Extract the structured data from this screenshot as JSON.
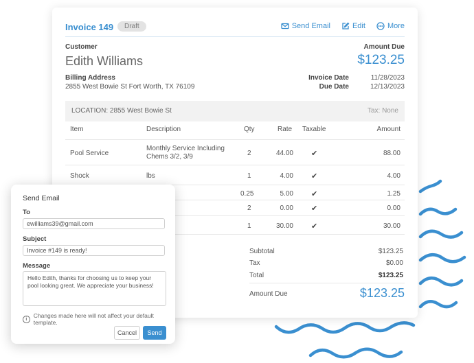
{
  "invoice": {
    "title": "Invoice 149",
    "status": "Draft",
    "actions": {
      "send_email": "Send Email",
      "edit": "Edit",
      "more": "More"
    },
    "customer_label": "Customer",
    "customer_name": "Edith Williams",
    "amount_due_label": "Amount Due",
    "amount_due": "$123.25",
    "billing_label": "Billing Address",
    "billing_address": "2855 West Bowie St Fort Worth, TX 76109",
    "invoice_date_label": "Invoice Date",
    "invoice_date": "11/28/2023",
    "due_date_label": "Due Date",
    "due_date": "12/13/2023",
    "location": "LOCATION: 2855 West Bowie St",
    "tax_label": "Tax: None",
    "columns": [
      "Item",
      "Description",
      "Qty",
      "Rate",
      "Taxable",
      "Amount"
    ],
    "rows": [
      {
        "item": "Pool Service",
        "desc": "Monthly Service Including Chems 3/2, 3/9",
        "qty": "2",
        "rate": "44.00",
        "taxable": "✔",
        "amount": "88.00"
      },
      {
        "item": "Shock",
        "desc": "lbs",
        "qty": "1",
        "rate": "4.00",
        "taxable": "✔",
        "amount": "4.00"
      },
      {
        "item": "",
        "desc": "",
        "qty": "0.25",
        "rate": "5.00",
        "taxable": "✔",
        "amount": "1.25"
      },
      {
        "item": "",
        "desc": "",
        "qty": "2",
        "rate": "0.00",
        "taxable": "✔",
        "amount": "0.00"
      },
      {
        "item": "",
        "desc": "",
        "qty": "1",
        "rate": "30.00",
        "taxable": "✔",
        "amount": "30.00"
      }
    ],
    "totals": {
      "subtotal_label": "Subtotal",
      "subtotal": "$123.25",
      "tax_label": "Tax",
      "tax": "$0.00",
      "total_label": "Total",
      "total": "$123.25",
      "amount_due_label": "Amount Due",
      "amount_due": "$123.25"
    }
  },
  "email": {
    "title": "Send Email",
    "to_label": "To",
    "to_value": "ewilliams39@gmail.com",
    "subject_label": "Subject",
    "subject_value": "Invoice #149 is ready!",
    "message_label": "Message",
    "message_value": "Hello Edith, thanks for choosing us to keep your pool looking great. We appreciate your business!",
    "note": "Changes made here will not affect your default template.",
    "cancel": "Cancel",
    "send": "Send"
  },
  "colors": {
    "accent": "#3a8fd0",
    "wave": "#3a8fd0"
  }
}
